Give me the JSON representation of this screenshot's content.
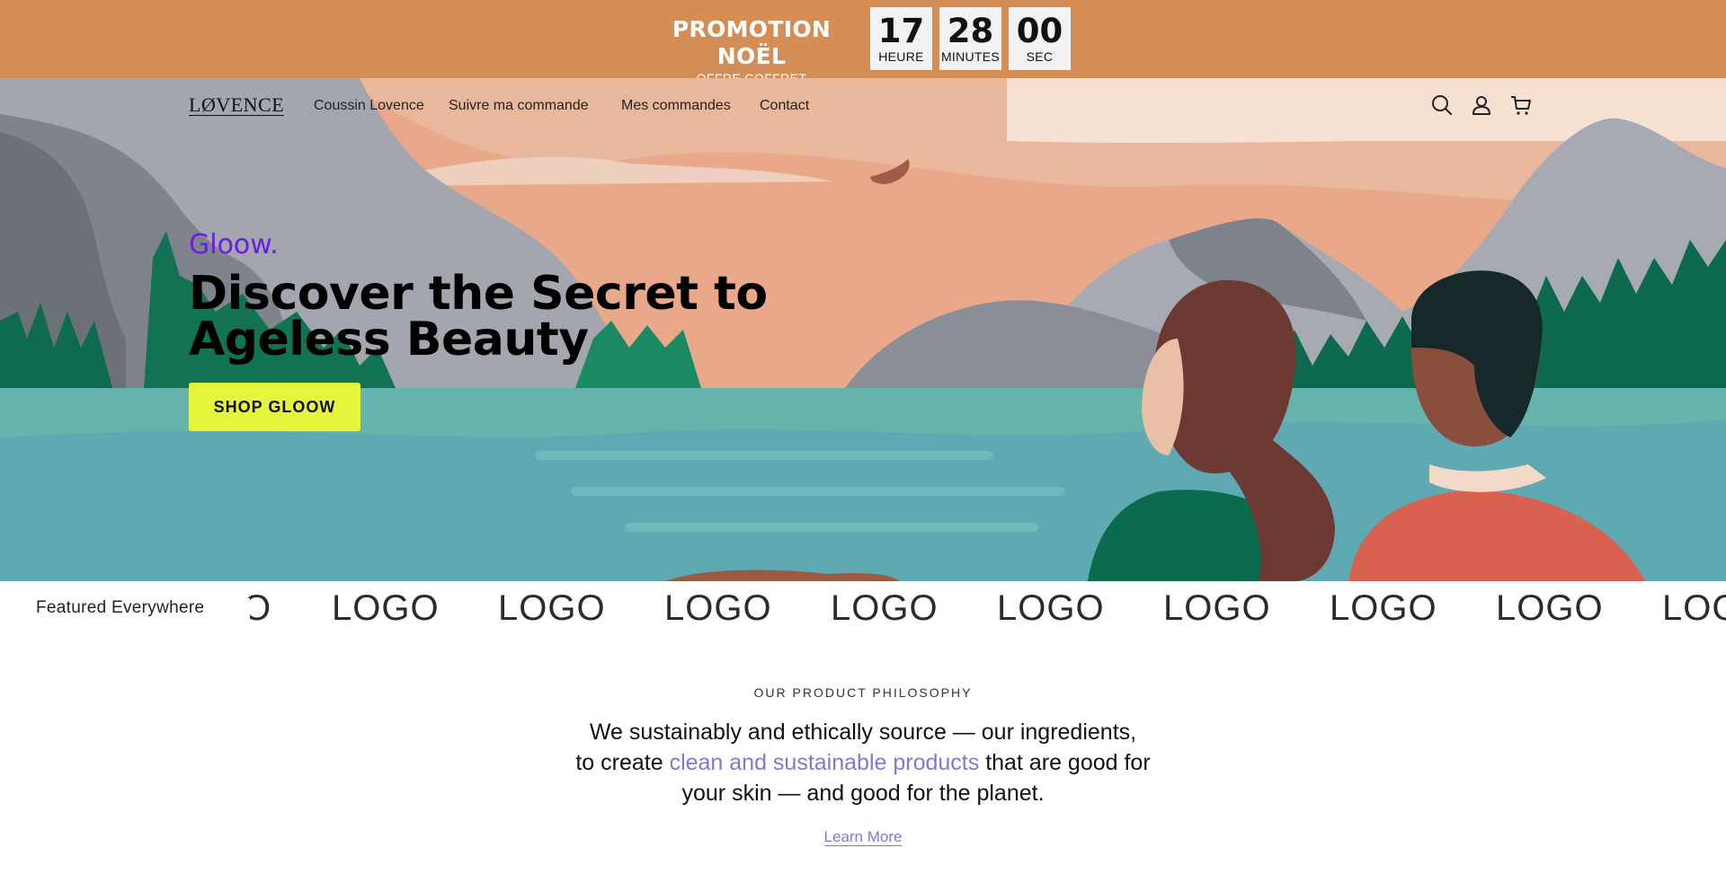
{
  "promo": {
    "title": "PROMOTION NOËL",
    "subtitle": "OFFRE COFFRET",
    "countdown": [
      {
        "value": "17",
        "label": "HEURE"
      },
      {
        "value": "28",
        "label": "MINUTES"
      },
      {
        "value": "00",
        "label": "SEC"
      }
    ],
    "bg_color": "#d58d56"
  },
  "header": {
    "logo": "LØVENCE",
    "nav": [
      "Coussin Lovence",
      "Suivre ma commande",
      "Mes commandes",
      "Contact"
    ],
    "icons": [
      "search-icon",
      "account-icon",
      "cart-icon"
    ]
  },
  "hero": {
    "kicker": "Gloow.",
    "title": "Discover the Secret to Ageless Beauty",
    "button": "SHOP GLOOW",
    "kicker_color": "#6a1ee0",
    "button_color": "#e4f53c"
  },
  "featured": {
    "label": "Featured Everywhere",
    "logos": [
      "O",
      "LOGO",
      "LOGO",
      "LOGO",
      "LOGO",
      "LOGO",
      "LOGO",
      "LOGO",
      "LOGO",
      "LOG"
    ]
  },
  "philosophy": {
    "kicker": "OUR PRODUCT PHILOSOPHY",
    "line1": "We sustainably and ethically source — our ingredients,",
    "line2_pre": "to create ",
    "line2_highlight": "clean and sustainable products",
    "line2_post": " that are good for",
    "line3": "your skin — and good for the planet.",
    "link": "Learn More",
    "accent_color": "#8a73d6"
  }
}
